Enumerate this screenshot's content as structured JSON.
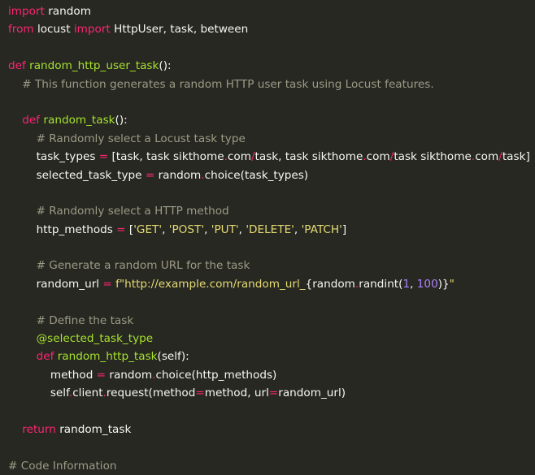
{
  "editor": {
    "colors": {
      "background": "#272822",
      "text": "#f8f8f2",
      "keyword": "#f92672",
      "function": "#a6e22e",
      "comment": "#9d9b86",
      "string": "#e6db74",
      "number": "#ae81ff"
    },
    "lines": [
      [
        {
          "t": "import",
          "c": "k"
        },
        {
          "t": " random",
          "c": "p"
        }
      ],
      [
        {
          "t": "from",
          "c": "k"
        },
        {
          "t": " locust ",
          "c": "p"
        },
        {
          "t": "import",
          "c": "k"
        },
        {
          "t": " HttpUser, task, between",
          "c": "p"
        }
      ],
      [],
      [
        {
          "t": "def",
          "c": "k"
        },
        {
          "t": " ",
          "c": "p"
        },
        {
          "t": "random_http_user_task",
          "c": "f"
        },
        {
          "t": "():",
          "c": "p"
        }
      ],
      [
        {
          "t": "    # This function generates a random HTTP user task using Locust features.",
          "c": "c"
        }
      ],
      [],
      [
        {
          "t": "    ",
          "c": "p"
        },
        {
          "t": "def",
          "c": "k"
        },
        {
          "t": " ",
          "c": "p"
        },
        {
          "t": "random_task",
          "c": "f"
        },
        {
          "t": "():",
          "c": "p"
        }
      ],
      [
        {
          "t": "        # Randomly select a Locust task type",
          "c": "c"
        }
      ],
      [
        {
          "t": "        task_types ",
          "c": "p"
        },
        {
          "t": "=",
          "c": "k"
        },
        {
          "t": " [task, task sikthome",
          "c": "p"
        },
        {
          "t": ".",
          "c": "k"
        },
        {
          "t": "com",
          "c": "p"
        },
        {
          "t": "/",
          "c": "k"
        },
        {
          "t": "task, task sikthome",
          "c": "p"
        },
        {
          "t": ".",
          "c": "k"
        },
        {
          "t": "com",
          "c": "p"
        },
        {
          "t": "/",
          "c": "k"
        },
        {
          "t": "task sikthome",
          "c": "p"
        },
        {
          "t": ".",
          "c": "k"
        },
        {
          "t": "com",
          "c": "p"
        },
        {
          "t": "/",
          "c": "k"
        },
        {
          "t": "task]",
          "c": "p"
        }
      ],
      [
        {
          "t": "        selected_task_type ",
          "c": "p"
        },
        {
          "t": "=",
          "c": "k"
        },
        {
          "t": " random",
          "c": "p"
        },
        {
          "t": ".",
          "c": "k"
        },
        {
          "t": "choice(task_types)",
          "c": "p"
        }
      ],
      [],
      [
        {
          "t": "        # Randomly select a HTTP method",
          "c": "c"
        }
      ],
      [
        {
          "t": "        http_methods ",
          "c": "p"
        },
        {
          "t": "=",
          "c": "k"
        },
        {
          "t": " [",
          "c": "p"
        },
        {
          "t": "'GET'",
          "c": "s"
        },
        {
          "t": ", ",
          "c": "p"
        },
        {
          "t": "'POST'",
          "c": "s"
        },
        {
          "t": ", ",
          "c": "p"
        },
        {
          "t": "'PUT'",
          "c": "s"
        },
        {
          "t": ", ",
          "c": "p"
        },
        {
          "t": "'DELETE'",
          "c": "s"
        },
        {
          "t": ", ",
          "c": "p"
        },
        {
          "t": "'PATCH'",
          "c": "s"
        },
        {
          "t": "]",
          "c": "p"
        }
      ],
      [],
      [
        {
          "t": "        # Generate a random URL for the task",
          "c": "c"
        }
      ],
      [
        {
          "t": "        random_url ",
          "c": "p"
        },
        {
          "t": "=",
          "c": "k"
        },
        {
          "t": " ",
          "c": "p"
        },
        {
          "t": "f\"http://example.com/random_url_",
          "c": "s"
        },
        {
          "t": "{random",
          "c": "p"
        },
        {
          "t": ".",
          "c": "k"
        },
        {
          "t": "randint(",
          "c": "p"
        },
        {
          "t": "1",
          "c": "n"
        },
        {
          "t": ", ",
          "c": "p"
        },
        {
          "t": "100",
          "c": "n"
        },
        {
          "t": ")}",
          "c": "p"
        },
        {
          "t": "\"",
          "c": "s"
        }
      ],
      [],
      [
        {
          "t": "        # Define the task",
          "c": "c"
        }
      ],
      [
        {
          "t": "        @selected_task_type",
          "c": "d"
        }
      ],
      [
        {
          "t": "        ",
          "c": "p"
        },
        {
          "t": "def",
          "c": "k"
        },
        {
          "t": " ",
          "c": "p"
        },
        {
          "t": "random_http_task",
          "c": "f"
        },
        {
          "t": "(self):",
          "c": "p"
        }
      ],
      [
        {
          "t": "            method ",
          "c": "p"
        },
        {
          "t": "=",
          "c": "k"
        },
        {
          "t": " random",
          "c": "p"
        },
        {
          "t": ".",
          "c": "k"
        },
        {
          "t": "choice(http_methods)",
          "c": "p"
        }
      ],
      [
        {
          "t": "            self",
          "c": "p"
        },
        {
          "t": ".",
          "c": "k"
        },
        {
          "t": "client",
          "c": "p"
        },
        {
          "t": ".",
          "c": "k"
        },
        {
          "t": "request(method",
          "c": "p"
        },
        {
          "t": "=",
          "c": "k"
        },
        {
          "t": "method, url",
          "c": "p"
        },
        {
          "t": "=",
          "c": "k"
        },
        {
          "t": "random_url)",
          "c": "p"
        }
      ],
      [],
      [
        {
          "t": "    ",
          "c": "p"
        },
        {
          "t": "return",
          "c": "k"
        },
        {
          "t": " random_task",
          "c": "p"
        }
      ],
      [],
      [
        {
          "t": "# Code Information",
          "c": "c"
        }
      ]
    ]
  }
}
